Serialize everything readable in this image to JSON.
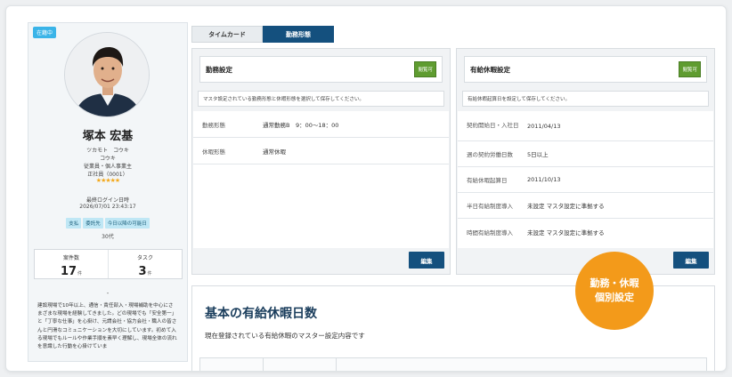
{
  "profile": {
    "status_badge": "在籍中",
    "name": "塚本 宏基",
    "kana_family": "ツカモト　コウキ",
    "kana_given": "コウキ",
    "department": "従業員・個人事業主",
    "employee_no": "正社員（0001）",
    "rating_stars": "★★★★★",
    "rating_value": 4.5,
    "last_login_label": "最終ログイン日時",
    "last_login": "2026/07/01 23:43:17",
    "tags": [
      "支払",
      "委託先",
      "今日以降の可能日"
    ],
    "age": "30代",
    "counts": [
      {
        "label": "案件数",
        "value": "17",
        "unit": "件"
      },
      {
        "label": "タスク",
        "value": "3",
        "unit": "件"
      }
    ],
    "dash": "-",
    "bio": "建設現場で10年以上、通信・責任部入・現場補助を中心にさまざまな現場を経験してきました。どの現場でも「安全第一」と「丁寧な仕事」を心掛け、元請会社・協力会社・職人の皆さんと円滑なコミュニケーションを大切にしています。初めて入る現場でもルールや作業手順を素早く理解し、現場全体の流れを意識した行動を心掛けていま"
  },
  "tabs": [
    {
      "label": "タイムカード",
      "active": false
    },
    {
      "label": "勤務形態",
      "active": true
    }
  ],
  "work_settings": {
    "title": "勤務設定",
    "view_label": "閲覧可",
    "note": "マスタ設定されている勤務形態と休暇形態を選択して保存してください。",
    "rows": [
      {
        "label": "勤務形態",
        "value": "通常勤務B　9：00〜18：00"
      },
      {
        "label": "休暇形態",
        "value": "通常休暇"
      }
    ],
    "edit_label": "編集"
  },
  "leave_settings": {
    "title": "有給休暇設定",
    "view_label": "閲覧可",
    "note": "有給休暇起算日を設定して保存してください。",
    "rows": [
      {
        "label": "契約開始日・入社日",
        "value": "2011/04/13"
      },
      {
        "label": "週の契約労働日数",
        "value": "5日以上"
      },
      {
        "label": "有給休暇起算日",
        "value": "2011/10/13"
      },
      {
        "label": "半日有給制度導入",
        "value": "未設定 マスタ設定に準拠する"
      },
      {
        "label": "時間有給制度導入",
        "value": "未設定 マスタ設定に準拠する"
      }
    ],
    "edit_label": "編集"
  },
  "basic_leave": {
    "title": "基本の有給休暇日数",
    "subtitle": "現在登録されている有給休暇のマスター設定内容です"
  },
  "promo": {
    "line1": "勤務・休暇",
    "line2": "個別設定"
  },
  "colors": {
    "primary": "#14507e",
    "accent_orange": "#f39a1a",
    "view_green": "#5f9c30",
    "status_blue": "#3ab4e8"
  }
}
